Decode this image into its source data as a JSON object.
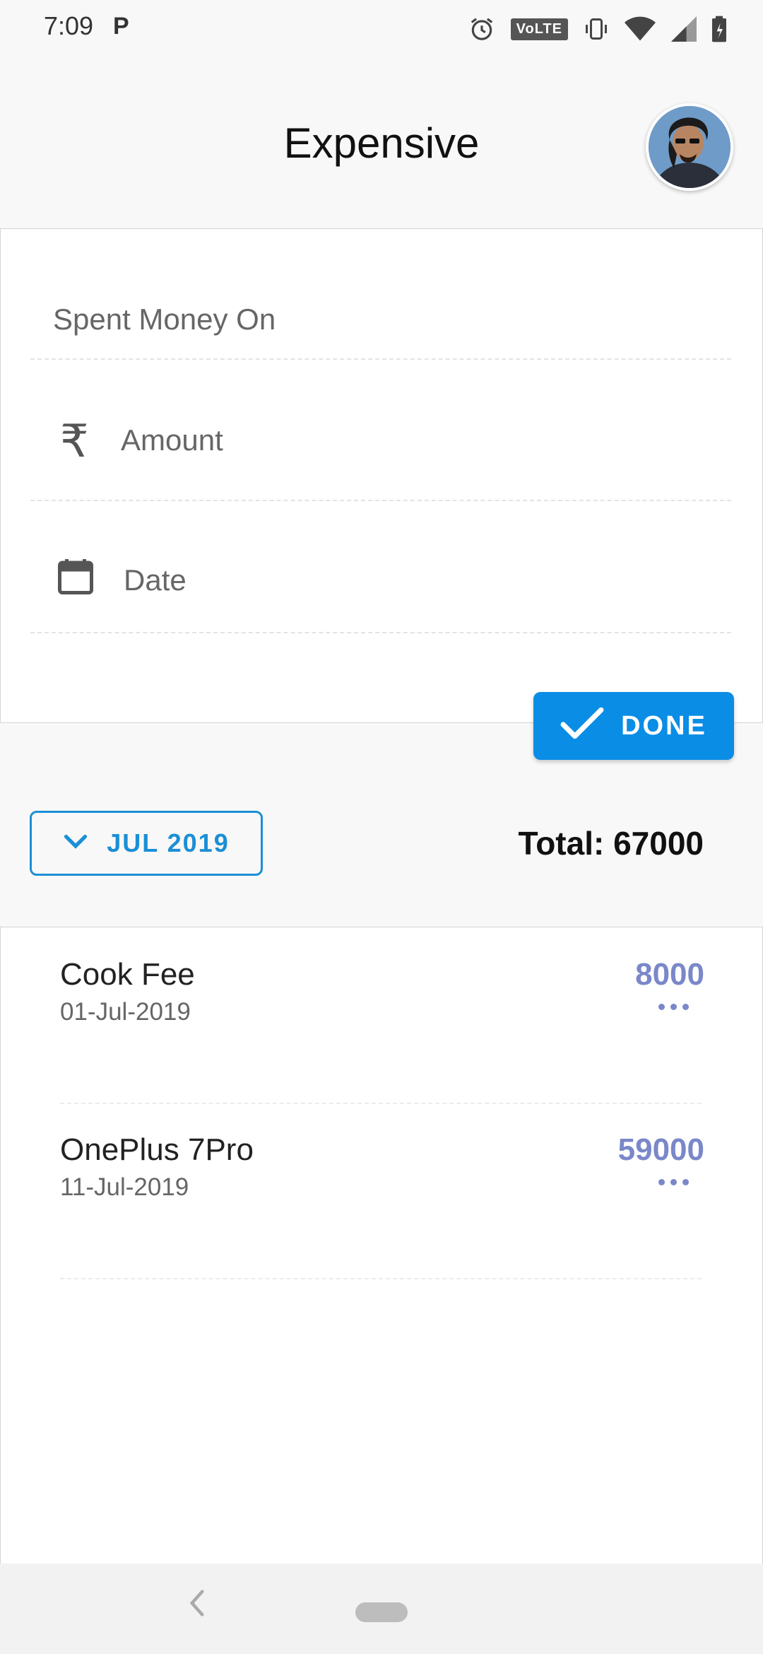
{
  "status_bar": {
    "time": "7:09",
    "notification": "P",
    "volte": "VoLTE",
    "icons": [
      "alarm-icon",
      "vibrate-icon",
      "wifi-icon",
      "signal-icon",
      "battery-icon"
    ]
  },
  "header": {
    "title": "Expensive",
    "avatar": "profile-avatar"
  },
  "form": {
    "spent_on_placeholder": "Spent Money On",
    "amount_placeholder": "Amount",
    "date_placeholder": "Date",
    "amount_icon": "₹",
    "done_label": "DONE"
  },
  "filter": {
    "month_label": "JUL 2019",
    "total_label": "Total: 67000"
  },
  "expenses": [
    {
      "name": "Cook Fee",
      "date": "01-Jul-2019",
      "amount": "8000"
    },
    {
      "name": "OnePlus 7Pro",
      "date": "11-Jul-2019",
      "amount": "59000"
    }
  ],
  "colors": {
    "primary": "#0a8de5",
    "accent": "#7a88c9",
    "background": "#f8f8f8"
  }
}
